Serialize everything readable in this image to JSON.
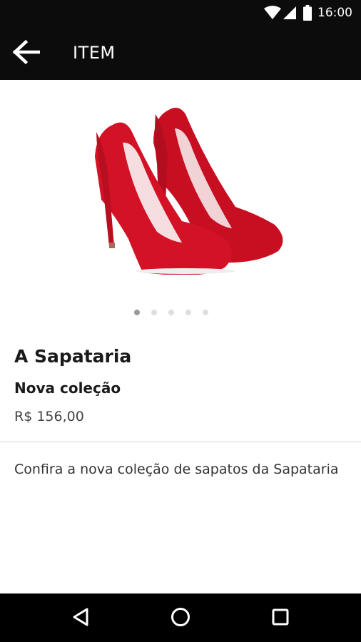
{
  "status_bar": {
    "time": "16:00",
    "icons": [
      "wifi-icon",
      "signal-icon",
      "battery-icon"
    ]
  },
  "app_bar": {
    "title": "ITEM",
    "back_icon": "arrow-back-icon"
  },
  "gallery": {
    "image": "red-high-heel-shoes",
    "page_count": 5,
    "active_page": 1
  },
  "item": {
    "store_name": "A Sapataria",
    "collection": "Nova coleção",
    "price": "R$ 156,00",
    "description": "Confira a nova coleção de sapatos da Sapataria"
  },
  "nav_bar": {
    "icons": [
      "back-triangle-icon",
      "home-circle-icon",
      "recents-square-icon"
    ]
  },
  "colors": {
    "bar_background": "#0c0c0c",
    "shoe_red": "#d41226",
    "dot_active": "#9a9a9a",
    "dot_inactive": "#dedede"
  }
}
